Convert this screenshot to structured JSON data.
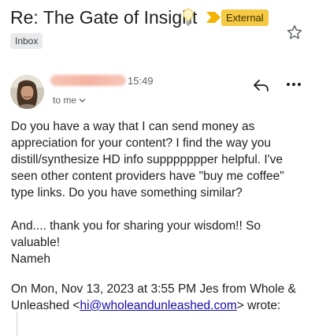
{
  "email": {
    "subject": "Re: The Gate of Insight",
    "external_badge": "External",
    "folder_label": "Inbox",
    "time": "15:49",
    "recipient": "to me",
    "body": [
      "Do you have a way that I can send money as appreciation for your content? I find the way you distill/synthesize HD info suppppppper helpful. I've seen other content providers have \"buy me coffee\" type links. Do you have something similar?",
      "And.... thank you for sharing your wisdom!! So valuable!",
      "Nameh"
    ],
    "quote_header": {
      "prefix": "On Mon, Nov 13, 2023 at 3:55 PM Jes from Whole & Unleashed <",
      "email": "hi@wholeandunleashed.com",
      "suffix": "> wrote:"
    }
  },
  "icons": {
    "subject_emoji": "lightbulb-icon",
    "importance": "importance-arrow-icon",
    "star": "star-icon",
    "reply": "reply-icon",
    "more": "more-options-icon",
    "expand": "chevron-down-icon"
  },
  "colors": {
    "external_badge": "#f6c944",
    "importance_arrow": "#f2b400",
    "link": "#1a0dab",
    "secondary_text": "#5f6368"
  }
}
